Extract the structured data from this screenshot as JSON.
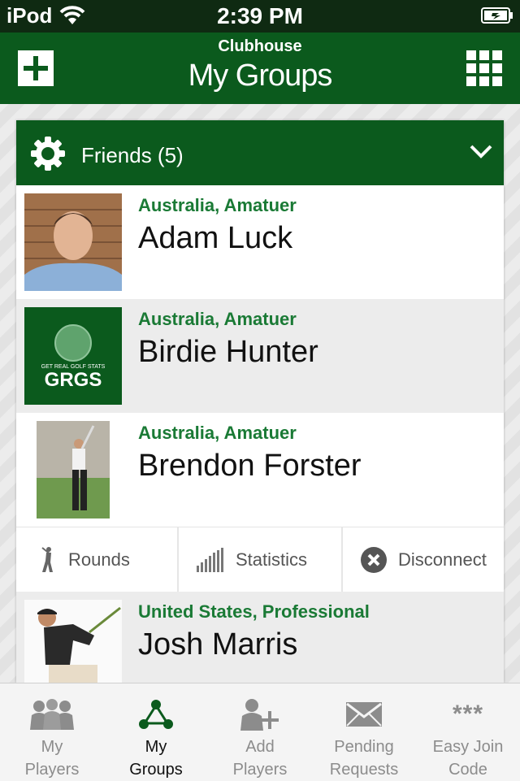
{
  "status_bar": {
    "carrier": "iPod",
    "time": "2:39 PM"
  },
  "nav": {
    "subtitle": "Clubhouse",
    "title": "My Groups"
  },
  "group": {
    "title": "Friends (5)"
  },
  "players": [
    {
      "meta": "Australia, Amatuer",
      "name": "Adam Luck",
      "photo_badge": ""
    },
    {
      "meta": "Australia, Amatuer",
      "name": "Birdie Hunter",
      "photo_badge": "GRGS",
      "photo_caption": "GET REAL GOLF STATS"
    },
    {
      "meta": "Australia, Amatuer",
      "name": "Brendon Forster",
      "photo_badge": ""
    },
    {
      "meta": "United States, Professional",
      "name": "Josh Marris",
      "photo_badge": ""
    }
  ],
  "actions": {
    "rounds": "Rounds",
    "statistics": "Statistics",
    "disconnect": "Disconnect"
  },
  "tabs": [
    {
      "line1": "My",
      "line2": "Players",
      "icon": "players-icon"
    },
    {
      "line1": "My",
      "line2": "Groups",
      "icon": "groups-icon"
    },
    {
      "line1": "Add",
      "line2": "Players",
      "icon": "add-player-icon"
    },
    {
      "line1": "Pending",
      "line2": "Requests",
      "icon": "envelope-icon"
    },
    {
      "line1": "Easy Join",
      "line2": "Code",
      "icon": "asterisks-icon",
      "icon_text": "***"
    }
  ],
  "colors": {
    "brand_green": "#0b5a1d",
    "meta_green": "#1a7a35",
    "status_bar": "#0f2a12"
  }
}
